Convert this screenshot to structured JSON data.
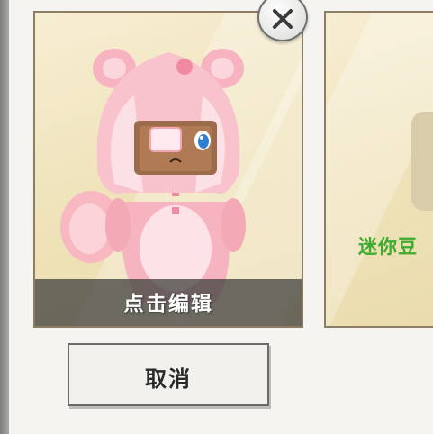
{
  "dialog": {
    "edit_label": "点击编辑",
    "cancel_label": "取消",
    "next_card_label": "迷你豆",
    "close_icon": "close-icon"
  },
  "colors": {
    "card_background": "#efe2b8",
    "footer_overlay": "#46463f",
    "next_card_label": "#3eac2c",
    "avatar_pink": "#f6b8c4"
  }
}
